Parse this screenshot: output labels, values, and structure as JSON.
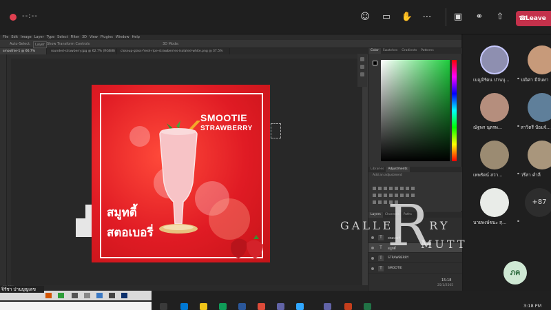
{
  "meeting": {
    "timer": "--:--",
    "leave_label": "Leave",
    "icons": [
      "people-icon",
      "chat-icon",
      "react-icon",
      "more-icon",
      "camera-off-icon",
      "mic-off-icon",
      "share-icon"
    ]
  },
  "photoshop": {
    "menu": [
      "File",
      "Edit",
      "Image",
      "Layer",
      "Type",
      "Select",
      "Filter",
      "3D",
      "View",
      "Plugins",
      "Window",
      "Help"
    ],
    "options": [
      "Auto-Select:",
      "Layer",
      "Show Transform Controls",
      "3D Mode:"
    ],
    "tabs": [
      "smoothie-1 @ 66.7% (RGB/8)",
      "rounded-strawberry.jpg @ 62.7% (RGB/8)",
      "closeup-glass-fresh-ripe-strawberries-isolated-white.png @ 37.5% (RGB/8)"
    ],
    "status": "66.67%",
    "design": {
      "title1": "SMOOTIE",
      "title2": "STRAWBERRY",
      "thai_line1": "สมูทตี้",
      "thai_line2": "สตอเบอรี่"
    },
    "panels": {
      "color_tabs": [
        "Color",
        "Swatches",
        "Gradients",
        "Patterns"
      ],
      "adj_tabs": [
        "Libraries",
        "Adjustments"
      ],
      "adj_label": "Add an adjustment",
      "layer_tabs": [
        "Layers",
        "Channels",
        "Paths"
      ],
      "layers": [
        {
          "name": "สตอเบอรี่",
          "type": "T",
          "selected": false
        },
        {
          "name": "สมูทตี้",
          "type": "T",
          "selected": true
        },
        {
          "name": "STRAWBERRY",
          "type": "T",
          "selected": false
        },
        {
          "name": "SMOOTIE",
          "type": "T",
          "selected": false
        }
      ],
      "time": "15:18",
      "date": "25/1/2565"
    }
  },
  "watermark": {
    "letter": "R",
    "left": "GALLE",
    "mid": "RY",
    "right": "MUTT"
  },
  "participants": [
    {
      "name": "เบญจิรัตน ปานบุ...",
      "muted": true
    },
    {
      "name": "ปณิศา มีจันทา",
      "muted": true
    },
    {
      "name": "ณัฐพร นุตรพ...",
      "muted": true
    },
    {
      "name": "สาวิตรี ป้อมจั...",
      "muted": true
    },
    {
      "name": "เทพรัตน์ สว่า...",
      "muted": true
    },
    {
      "name": "วรีสา คำลี",
      "muted": true
    },
    {
      "name": "นายพงษ์ชนะ สุ...",
      "muted": true
    }
  ],
  "more_count": "+87",
  "self_initials": "ภค",
  "speaker": "จิรัชา ปานบุญเลข",
  "clock": {
    "time": "3:18 PM"
  }
}
